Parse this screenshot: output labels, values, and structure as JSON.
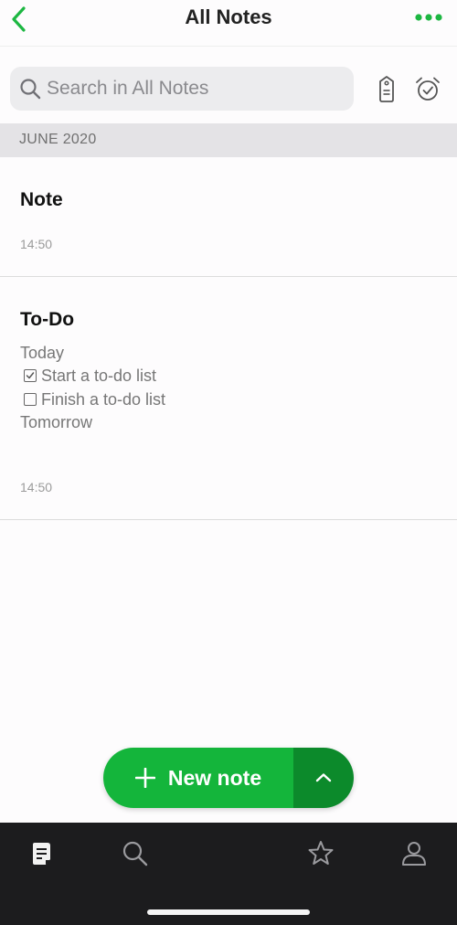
{
  "header": {
    "title": "All Notes",
    "accent_color": "#1db742"
  },
  "search": {
    "placeholder": "Search in All Notes"
  },
  "section": {
    "label": "JUNE 2020"
  },
  "notes": [
    {
      "title": "Note",
      "time": "14:50"
    },
    {
      "title": "To-Do",
      "lines": [
        {
          "text": "Today"
        },
        {
          "text": "Start a to-do list",
          "checkbox": "checked"
        },
        {
          "text": "Finish a to-do list",
          "checkbox": "unchecked"
        },
        {
          "text": "Tomorrow"
        }
      ],
      "time": "14:50"
    }
  ],
  "fab": {
    "label": "New note",
    "color": "#14b53b",
    "secondary_color": "#0c8a2b"
  },
  "tabbar": {
    "icons": [
      "notes-icon",
      "search-icon",
      "star-icon",
      "account-icon"
    ],
    "background": "#1c1c1e"
  }
}
